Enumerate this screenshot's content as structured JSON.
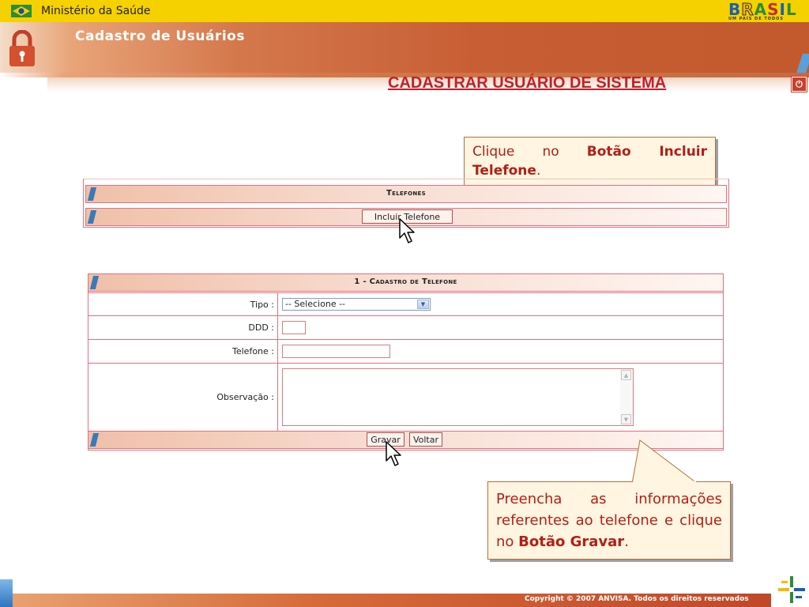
{
  "top_bar": {
    "ministry": "Ministério da Saúde",
    "brasil_word": [
      "B",
      "R",
      "A",
      "S",
      "I",
      "L"
    ],
    "brasil_slogan": "UM PAÍS DE TODOS"
  },
  "header": {
    "section_title": "Cadastro de Usuários",
    "page_heading": "CADASTRAR USUÁRIO DE SISTEMA",
    "power_glyph": "⏻"
  },
  "callouts": {
    "top": {
      "prefix": "Clique no ",
      "bold": "Botão Incluir Telefone",
      "suffix": "."
    },
    "bottom": {
      "prefix": "Preencha as informações referentes ao telefone e clique no ",
      "bold": "Botão Gravar",
      "suffix": "."
    }
  },
  "telefones_panel": {
    "title": "Telefones",
    "incluir_button": "Incluir Telefone"
  },
  "form": {
    "title": "1 - Cadastro de Telefone",
    "tipo": {
      "label": "Tipo :",
      "selected": "-- Selecione --"
    },
    "ddd": {
      "label": "DDD :",
      "value": ""
    },
    "telefone": {
      "label": "Telefone :",
      "value": ""
    },
    "observacao": {
      "label": "Observação :",
      "value": ""
    },
    "gravar_button": "Gravar",
    "voltar_button": "Voltar"
  },
  "footer": {
    "copyright": "Copyright © 2007 ANVISA. Todos os direitos reservados"
  },
  "colors": {
    "accent_red": "#c0202a",
    "header_orange": "#c85e34",
    "top_yellow": "#f5d100",
    "ribbon_blue": "#3a7ab8"
  },
  "icons": [
    "flag-icon",
    "lock-icon",
    "power-icon",
    "dropdown-arrow-icon",
    "scroll-up-icon",
    "scroll-down-icon",
    "cursor-icon",
    "anvisa-logo-icon"
  ]
}
